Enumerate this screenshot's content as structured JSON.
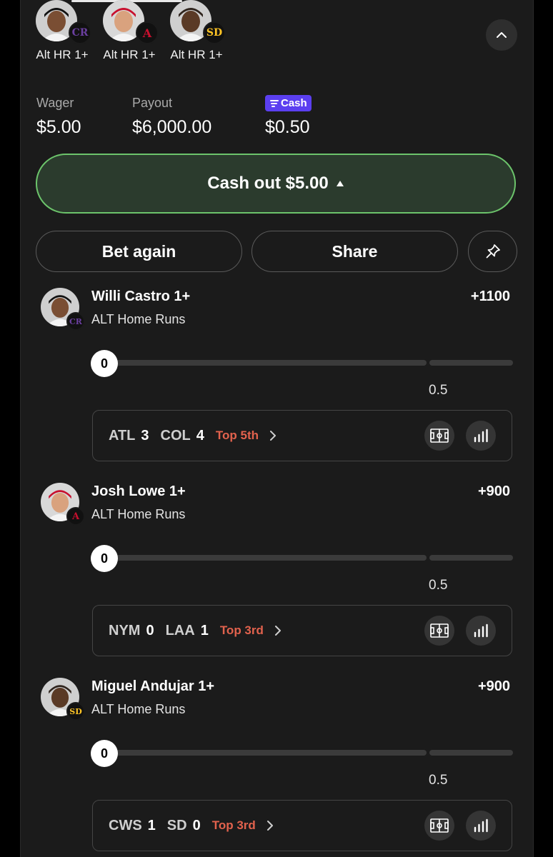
{
  "legs_header": [
    {
      "label": "Alt HR 1+",
      "team_logo": "rockies-logo",
      "team_color": "#6b3fa0"
    },
    {
      "label": "Alt HR 1+",
      "team_logo": "angels-logo",
      "team_color": "#c8102e"
    },
    {
      "label": "Alt HR 1+",
      "team_logo": "padres-logo",
      "team_color": "#ffc425"
    }
  ],
  "summary": {
    "wager_label": "Wager",
    "wager_value": "$5.00",
    "payout_label": "Payout",
    "payout_value": "$6,000.00",
    "fcash_badge": "Cash",
    "fcash_value": "$0.50"
  },
  "actions": {
    "cashout_label": "Cash out $5.00",
    "bet_again_label": "Bet again",
    "share_label": "Share",
    "pin_icon": "pin-icon",
    "collapse_icon": "chevron-up-icon"
  },
  "colors": {
    "cashout_border": "#6cc46b",
    "cashout_bg": "#2b3b2d",
    "inning_red": "#e2624d",
    "fcash_purple": "#5b3ff0"
  },
  "bets": [
    {
      "player": "Willi Castro 1+",
      "market": "ALT Home Runs",
      "odds": "+1100",
      "progress_value": "0",
      "threshold": "0.5",
      "game": {
        "away": "ATL",
        "away_score": "3",
        "home": "COL",
        "home_score": "4",
        "status": "Top 5th"
      }
    },
    {
      "player": "Josh Lowe 1+",
      "market": "ALT Home Runs",
      "odds": "+900",
      "progress_value": "0",
      "threshold": "0.5",
      "game": {
        "away": "NYM",
        "away_score": "0",
        "home": "LAA",
        "home_score": "1",
        "status": "Top 3rd"
      }
    },
    {
      "player": "Miguel Andujar 1+",
      "market": "ALT Home Runs",
      "odds": "+900",
      "progress_value": "0",
      "threshold": "0.5",
      "game": {
        "away": "CWS",
        "away_score": "1",
        "home": "SD",
        "home_score": "0",
        "status": "Top 3rd"
      }
    }
  ]
}
